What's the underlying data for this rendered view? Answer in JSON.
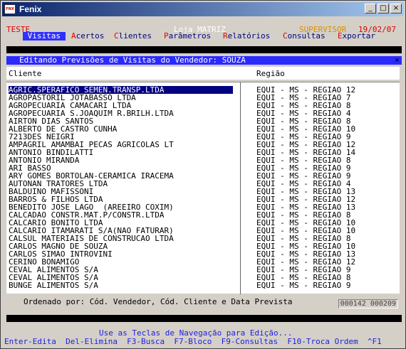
{
  "window": {
    "title": "Fenix",
    "icon": "fenix-app-icon",
    "icon_text": "FNX",
    "btn_min": "_",
    "btn_max": "□",
    "btn_close": "×"
  },
  "header": {
    "company": "TESTE",
    "store": "Loja MATRIZ",
    "user": "SUPERVISOR",
    "date": "19/02/07"
  },
  "menu": [
    {
      "hotkey": "V",
      "rest": "isitas",
      "active": true
    },
    {
      "hotkey": "A",
      "rest": "certos",
      "active": false
    },
    {
      "hotkey": "C",
      "rest": "lientes",
      "active": false
    },
    {
      "hotkey": "P",
      "rest": "arâmetros",
      "active": false
    },
    {
      "hotkey": "R",
      "rest": "elatórios",
      "active": false
    },
    {
      "hotkey": "C",
      "rest": "onsultas",
      "active": false
    },
    {
      "hotkey": "E",
      "rest": "xportar",
      "active": false
    }
  ],
  "dialog": {
    "title": "Editando Previsões de Visitas do Vendedor: SOUZA",
    "close": "×",
    "scroll_indicator": ">",
    "col_client": "Cliente",
    "col_region": "Região",
    "footer": "Ordenado por: Cód. Vendedor, Cód. Cliente e Data Prevista",
    "counter": "000142 000209"
  },
  "rows": [
    {
      "client": "AGRIC.SPERAFICO SEMEN.TRANSP.LTDA",
      "region": "EQUI - MS - REGIAO 12",
      "selected": true
    },
    {
      "client": "AGROPASTORIL JOTABASSO LTDA",
      "region": "EQUI - MS - REGIAO 7"
    },
    {
      "client": "AGROPECUARIA CAMACARI LTDA",
      "region": "EQUI - MS - REGIAO 8"
    },
    {
      "client": "AGROPECUARIA S.JOAQUIM R.BRILH.LTDA",
      "region": "EQUI - MS - REGIAO 4"
    },
    {
      "client": "AIRTON DIAS SANTOS",
      "region": "EQUI - MS - REGIAO 8"
    },
    {
      "client": "ALBERTO DE CASTRO CUNHA",
      "region": "EQUI - MS - REGIAO 10"
    },
    {
      "client": "7213DES NEIGRI",
      "region": "EQUI - MS - REGIAO 9"
    },
    {
      "client": "AMPAGRIL AMAMBAI PECAS AGRICOLAS LT",
      "region": "EQUI - MS - REGIAO 12"
    },
    {
      "client": "ANTONIO BINDILATTI",
      "region": "EQUI - MS - REGIAO 14"
    },
    {
      "client": "ANTONIO MIRANDA",
      "region": "EQUI - MS - REGIAO 8"
    },
    {
      "client": "ARI BASSO",
      "region": "EQUI - MS - REGIAO 9"
    },
    {
      "client": "ARY GOMES BORTOLAN-CERAMICA IRACEMA",
      "region": "EQUI - MS - REGIAO 9"
    },
    {
      "client": "AUTONAN TRATORES LTDA",
      "region": "EQUI - MS - REGIAO 4"
    },
    {
      "client": "BALDUINO MAFISSONI",
      "region": "EQUI - MS - REGIAO 13"
    },
    {
      "client": "BARROS & FILHOS LTDA",
      "region": "EQUI - MS - REGIAO 12"
    },
    {
      "client": "BENEDITO JOSE LAGO  (AREEIRO COXIM)",
      "region": "EQUI - MS - REGIAO 13"
    },
    {
      "client": "CALCADAO CONSTR.MAT.P/CONSTR.LTDA",
      "region": "EQUI - MS - REGIAO 8"
    },
    {
      "client": "CALCARIO BONITO LTDA",
      "region": "EQUI - MS - REGIAO 10"
    },
    {
      "client": "CALCARIO ITAMARATI S/A(NAO FATURAR)",
      "region": "EQUI - MS - REGIAO 10"
    },
    {
      "client": "CALSUL MATERIAIS DE CONSTRUCAO LTDA",
      "region": "EQUI - MS - REGIAO 8"
    },
    {
      "client": "CARLOS MAGNO DE SOUZA",
      "region": "EQUI - MS - REGIAO 10"
    },
    {
      "client": "CARLOS SIMAO INTROVINI",
      "region": "EQUI - MS - REGIAO 13"
    },
    {
      "client": "CERINO BONAMIGO",
      "region": "EQUI - MS - REGIAO 12"
    },
    {
      "client": "CEVAL ALIMENTOS S/A",
      "region": "EQUI - MS - REGIAO 9"
    },
    {
      "client": "CEVAL ALIMENTOS S/A",
      "region": "EQUI - MS - REGIAO 8"
    },
    {
      "client": "BUNGE ALIMENTOS S/A",
      "region": "EQUI - MS - REGIAO 9"
    }
  ],
  "help": {
    "line1": "Use as Teclas de Navegação para Edição...",
    "line2": "Enter-Edita  Del-Elimina  F3-Busca  F7-Bloco  F9-Consultas  F10-Troca Ordem  ^F1"
  },
  "colors": {
    "menu_active": "#3030ff",
    "dialog_title": "#2a2aff",
    "selection": "#000080",
    "hotkey": "#e00000",
    "help_text": "#2020e0"
  }
}
